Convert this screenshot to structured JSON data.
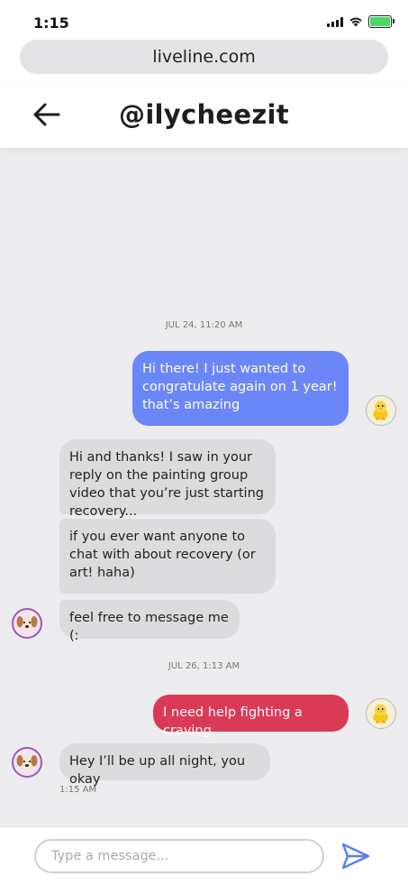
{
  "status_bar": {
    "time": "1:15"
  },
  "browser": {
    "url": "liveline.com"
  },
  "header": {
    "title": "@ilycheezit",
    "back_icon": "arrow-left-icon"
  },
  "messages": {
    "stamp1": "JUL 24, 11:20 AM",
    "m1": "Hi there! I just wanted to congratulate again on 1 year! that’s amazing",
    "m2": "Hi and thanks! I saw in your reply on the painting group video that you’re just starting recovery...",
    "m3": "if you ever want anyone to chat with about recovery (or art! haha)",
    "m4": "feel free to message me (:",
    "stamp2": "JUL 26, 1:13 AM",
    "m5": "I need help fighting a craving",
    "m6": "Hey I’ll be up all night, you okay",
    "m6_time": "1:15 AM"
  },
  "composer": {
    "placeholder": "Type a message...",
    "send_icon": "send-icon"
  },
  "colors": {
    "sent": "#6b86f7",
    "received": "#dcdcde",
    "urgent": "#d93a56",
    "accent": "#5b7cf5"
  }
}
